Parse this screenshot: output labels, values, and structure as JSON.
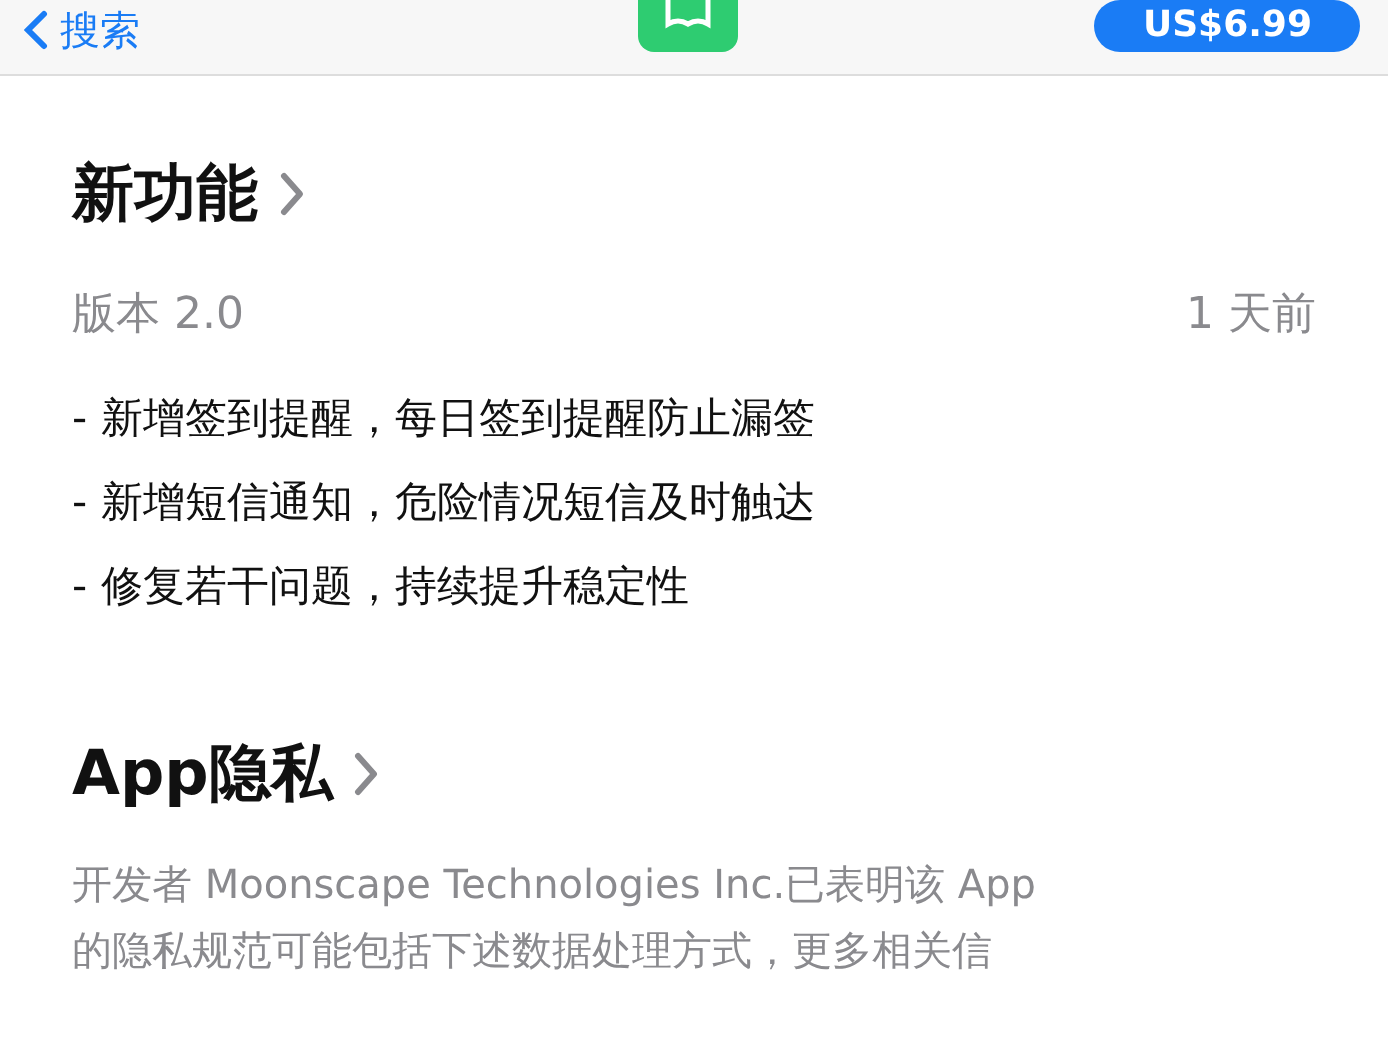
{
  "nav": {
    "back_label": "搜索",
    "price": "US$6.99"
  },
  "whats_new": {
    "title": "新功能",
    "version": "版本 2.0",
    "date": "1 天前",
    "notes": [
      "- 新增签到提醒，每日签到提醒防止漏签",
      "- 新增短信通知，危险情况短信及时触达",
      "- 修复若干问题，持续提升稳定性"
    ]
  },
  "privacy": {
    "title": "App隐私",
    "text": [
      "开发者 Moonscape Technologies Inc.已表明该 App",
      "的隐私规范可能包括下述数据处理方式，更多相关信"
    ]
  }
}
